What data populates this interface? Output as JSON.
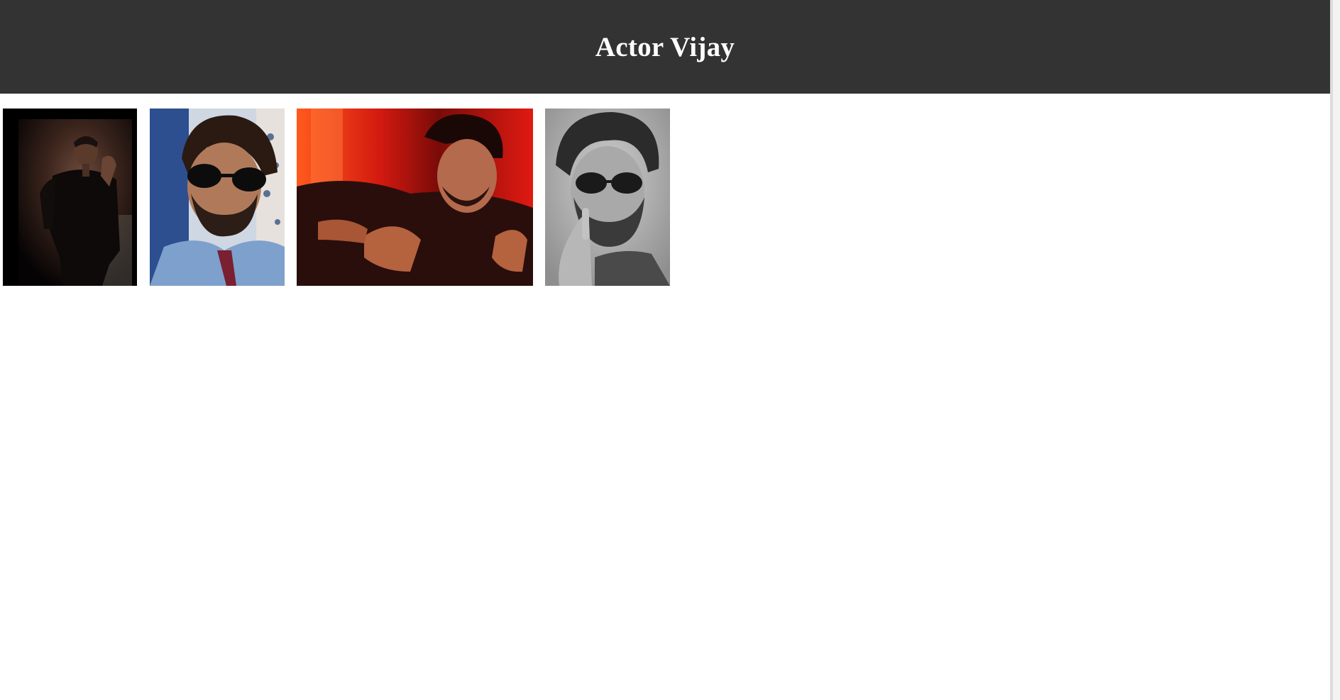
{
  "header": {
    "title": "Actor Vijay",
    "background": "#333333",
    "text_color": "#ffffff"
  },
  "gallery": {
    "photos": [
      {
        "alt": "",
        "tone": "dark"
      },
      {
        "alt": "",
        "tone": "blue"
      },
      {
        "alt": "",
        "tone": "red"
      },
      {
        "alt": "",
        "tone": "grayscale-sketch"
      }
    ]
  }
}
